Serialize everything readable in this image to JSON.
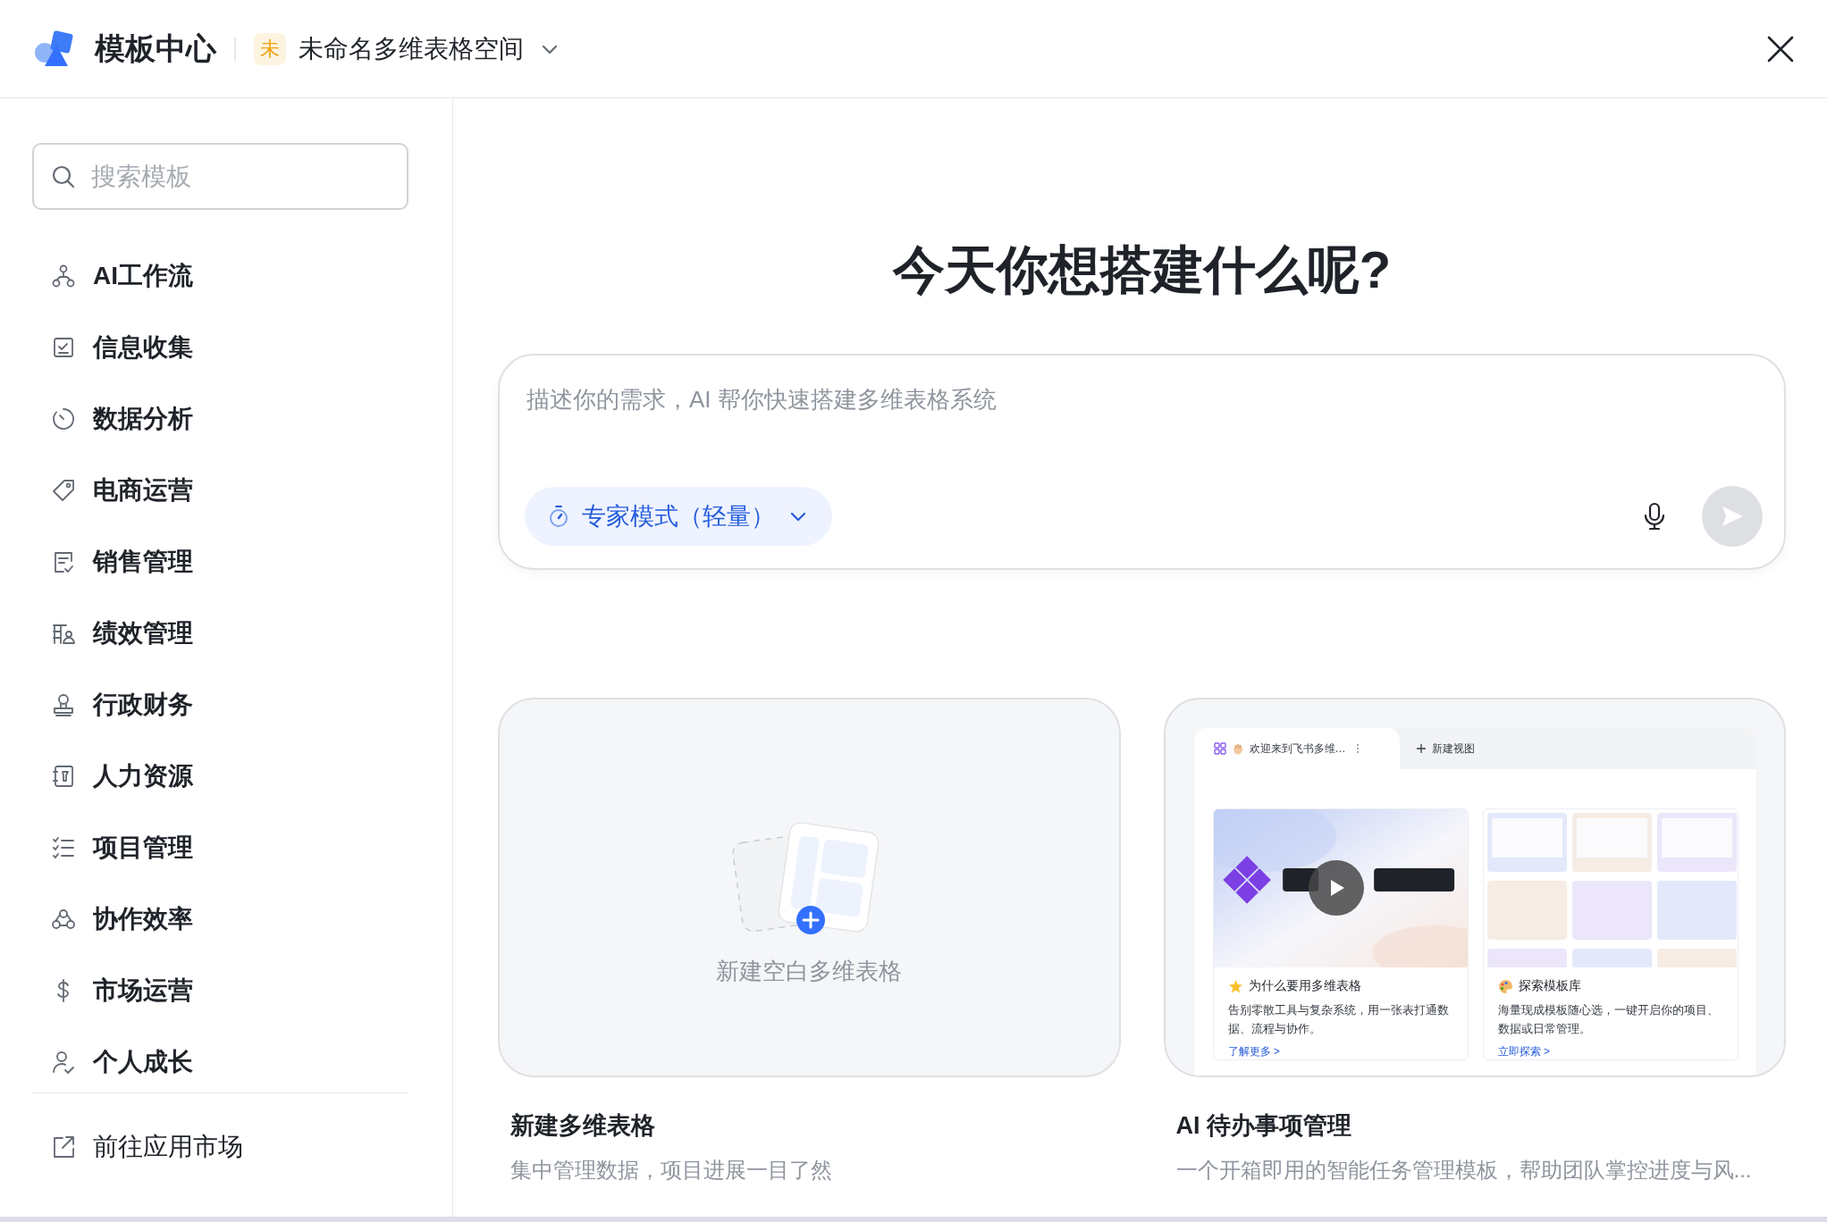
{
  "header": {
    "title": "模板中心",
    "workspace": {
      "avatar": "未",
      "name": "未命名多维表格空间"
    }
  },
  "sidebar": {
    "search": {
      "placeholder": "搜索模板"
    },
    "items": [
      {
        "label": "AI工作流"
      },
      {
        "label": "信息收集"
      },
      {
        "label": "数据分析"
      },
      {
        "label": "电商运营"
      },
      {
        "label": "销售管理"
      },
      {
        "label": "绩效管理"
      },
      {
        "label": "行政财务"
      },
      {
        "label": "人力资源"
      },
      {
        "label": "项目管理"
      },
      {
        "label": "协作效率"
      },
      {
        "label": "市场运营"
      },
      {
        "label": "个人成长"
      }
    ],
    "footer_link": "前往应用市场"
  },
  "main": {
    "headline": "今天你想搭建什么呢?",
    "prompt": {
      "placeholder": "描述你的需求，AI 帮你快速搭建多维表格系统",
      "mode": "专家模式（轻量）"
    },
    "cards": [
      {
        "kind": "blank",
        "caption": "新建空白多维表格",
        "title": "新建多维表格",
        "description": "集中管理数据，项目进展一目了然"
      },
      {
        "kind": "template",
        "preview": {
          "tab": "欢迎来到飞书多维…",
          "new_view": "新建视图",
          "panels": [
            {
              "kind": "video",
              "title": "为什么要用多维表格",
              "body": "告别零散工具与复杂系统，用一张表打通数据、流程与协作。",
              "link": "了解更多 >"
            },
            {
              "kind": "gallery",
              "title": "探索模板库",
              "body": "海量现成模板随心选，一键开启你的项目、数据或日常管理。",
              "link": "立即探索 >"
            }
          ]
        },
        "title": "AI 待办事项管理",
        "description": "一个开箱即用的智能任务管理模板，帮助团队掌控进度与风..."
      }
    ]
  }
}
